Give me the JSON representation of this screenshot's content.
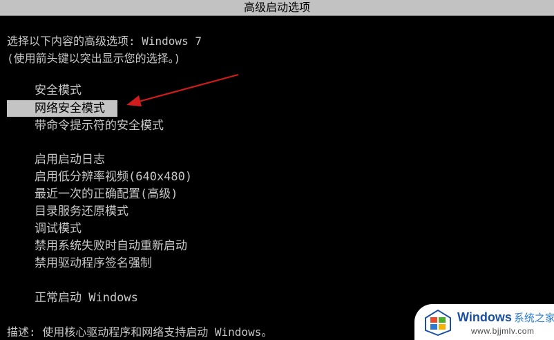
{
  "window": {
    "title": "高级启动选项"
  },
  "intro": {
    "line1": "选择以下内容的高级选项: Windows 7",
    "line2": "(使用箭头键以突出显示您的选择。)"
  },
  "menu": {
    "selected_index": 1,
    "groups": [
      [
        "安全模式",
        "网络安全模式",
        "带命令提示符的安全模式"
      ],
      [
        "启用启动日志",
        "启用低分辨率视频(640x480)",
        "最近一次的正确配置(高级)",
        "目录服务还原模式",
        "调试模式",
        "禁用系统失败时自动重新启动",
        "禁用驱动程序签名强制"
      ],
      [
        "正常启动 Windows"
      ]
    ]
  },
  "description": "描述: 使用核心驱动程序和网络支持启动 Windows。",
  "colors": {
    "background": "#000000",
    "text": "#c8c8c8",
    "highlight": "#c4c4c4",
    "arrow": "#d01c1c"
  },
  "watermark": {
    "logo_icon": "windows-logo-icon",
    "title": "Windows",
    "title_accent": "系统之家",
    "url": "www.bjjmlv.com"
  }
}
